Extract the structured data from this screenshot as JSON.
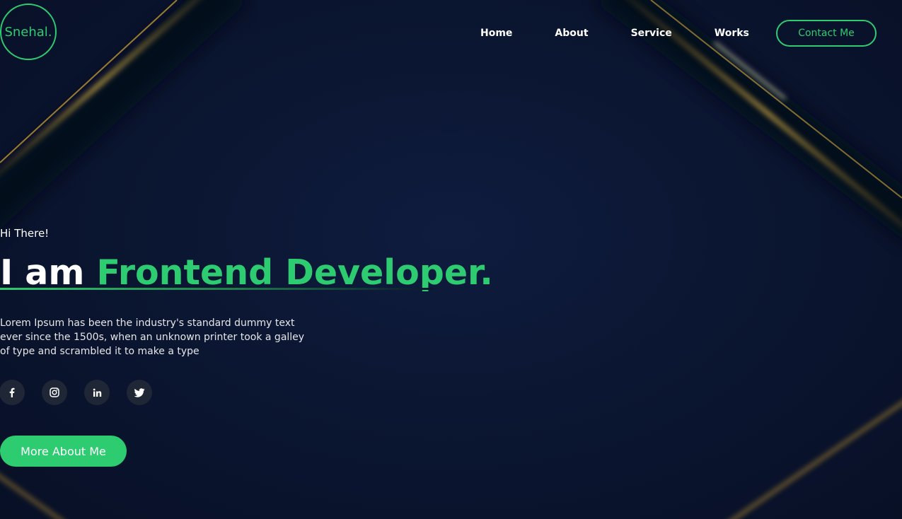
{
  "brand": {
    "logo_text": "Snehal."
  },
  "nav": {
    "items": [
      "Home",
      "About",
      "Service",
      "Works"
    ],
    "contact_label": "Contact Me"
  },
  "hero": {
    "greeting": "Hi There!",
    "headline_prefix": "I am ",
    "headline_accent": "Frontend Developer.",
    "description": "Lorem Ipsum has been the industry's standard dummy text ever since the 1500s, when an unknown printer took a galley of type and scrambled it to make a type",
    "cta_label": "More About Me"
  },
  "socials": [
    "facebook-icon",
    "instagram-icon",
    "linkedin-icon",
    "twitter-icon"
  ],
  "colors": {
    "accent": "#2ecc71",
    "background": "#0b1530",
    "gold": "#c99a2e"
  }
}
